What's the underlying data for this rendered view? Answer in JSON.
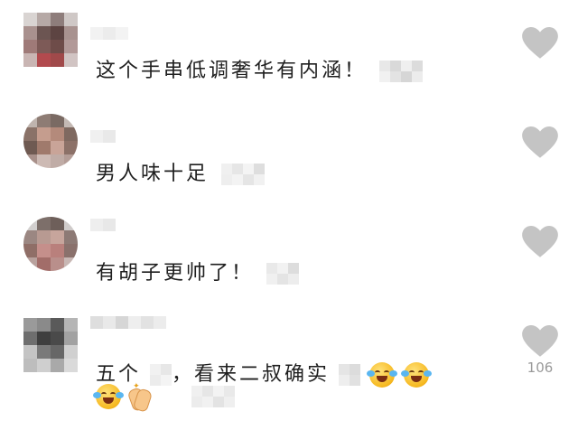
{
  "comments": [
    {
      "text": "这个手串低调奢华有内涵！",
      "liked": false
    },
    {
      "text": "男人味十足",
      "liked": false
    },
    {
      "text": "有胡子更帅了！",
      "liked": false
    },
    {
      "text_before": "五个",
      "text_after": "，看来二叔确实",
      "like_count": "106",
      "emojis": [
        "face-with-tears-of-joy",
        "face-with-tears-of-joy",
        "face-with-tears-of-joy",
        "clapping-hands"
      ],
      "liked": false
    }
  ],
  "icons": {
    "like": "heart-icon"
  },
  "colors": {
    "heart": "#c4c4c4",
    "like_count": "#9a9a9a",
    "text": "#1f1f1f"
  }
}
